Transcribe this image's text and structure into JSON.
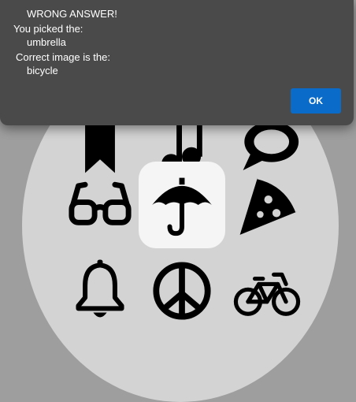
{
  "dialog": {
    "line1": "WRONG ANSWER!",
    "line2": "You picked the:",
    "picked": "umbrella",
    "line4": "Correct image is the:",
    "correct": "bicycle",
    "ok_label": "OK"
  },
  "grid": {
    "icons": [
      "bookmark-icon",
      "music-note-icon",
      "speech-bubble-icon",
      "glasses-icon",
      "umbrella-icon",
      "pizza-slice-icon",
      "bell-icon",
      "peace-icon",
      "bicycle-icon"
    ],
    "selected": "umbrella-icon"
  },
  "colors": {
    "dialog_bg": "#4a4a4a",
    "ok_button": "#0a6cc8",
    "circle": "#d3d3d3",
    "selected_tile": "#f5f5f5"
  }
}
